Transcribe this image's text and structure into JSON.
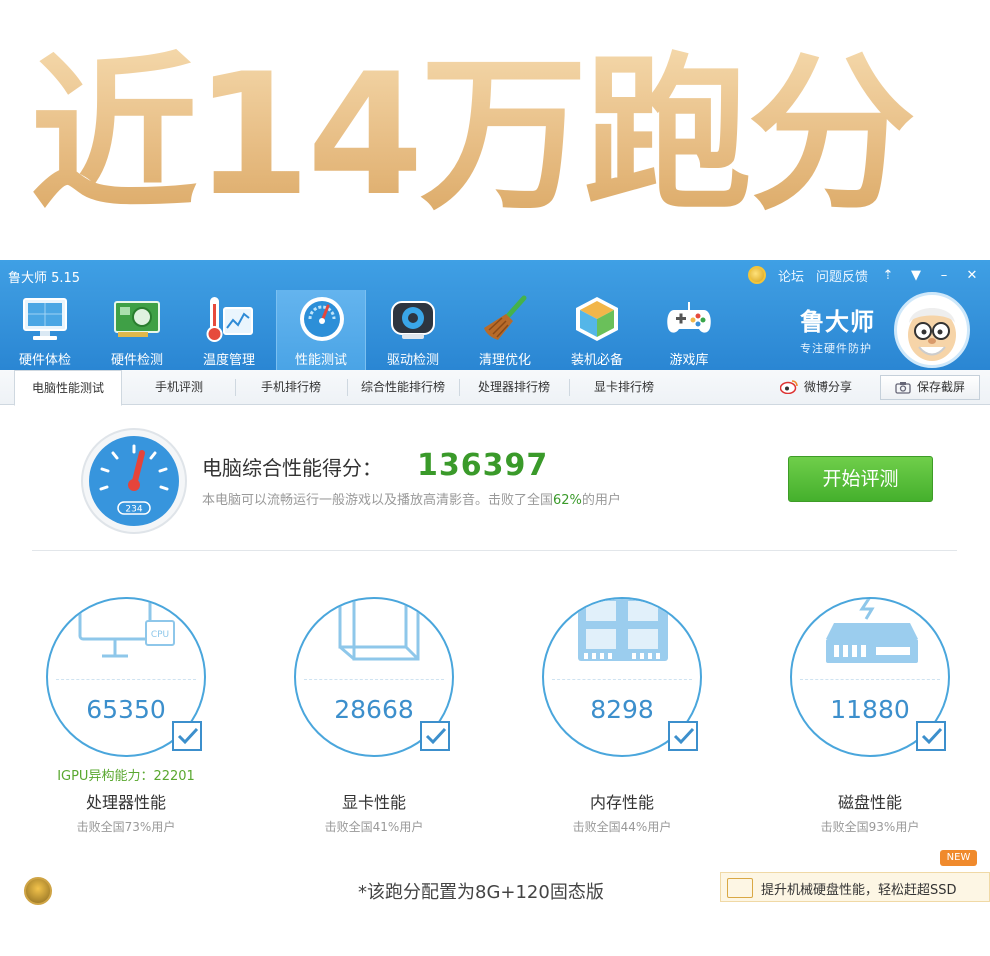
{
  "promo": {
    "headline": "近14万跑分"
  },
  "window": {
    "title": "鲁大师 5.15",
    "links": [
      "论坛",
      "问题反馈"
    ],
    "controls": [
      "skin-icon",
      "menu-icon",
      "minimize-icon",
      "close-icon"
    ]
  },
  "toolbar": {
    "items": [
      {
        "label": "硬件体检",
        "icon": "monitor-check-icon"
      },
      {
        "label": "硬件检测",
        "icon": "hardware-card-icon"
      },
      {
        "label": "温度管理",
        "icon": "thermometer-icon"
      },
      {
        "label": "性能测试",
        "icon": "speedometer-icon",
        "active": true
      },
      {
        "label": "驱动检测",
        "icon": "driver-gear-icon"
      },
      {
        "label": "清理优化",
        "icon": "broom-icon"
      },
      {
        "label": "装机必备",
        "icon": "box-icon"
      },
      {
        "label": "游戏库",
        "icon": "gamepad-icon"
      }
    ],
    "brand_name": "鲁大师",
    "brand_slogan": "专注硬件防护"
  },
  "tabs": {
    "items": [
      "电脑性能测试",
      "手机评测",
      "手机排行榜",
      "综合性能排行榜",
      "处理器排行榜",
      "显卡排行榜"
    ],
    "active": 0,
    "share": "微博分享",
    "save": "保存截屏"
  },
  "score": {
    "label": "电脑综合性能得分：",
    "value": "136397",
    "gauge_readout": "234",
    "desc_prefix": "本电脑可以流畅运行一般游戏以及播放高清影音。击败了全国",
    "desc_percent": "62%",
    "desc_suffix": "的用户",
    "start_button": "开始评测"
  },
  "components": [
    {
      "name": "处理器性能",
      "score": "65350",
      "defeat": "击败全国73%用户",
      "extra": "IGPU异构能力：22201",
      "icon": "cpu-monitor-icon"
    },
    {
      "name": "显卡性能",
      "score": "28668",
      "defeat": "击败全国41%用户",
      "extra": "",
      "icon": "gpu-cube-icon"
    },
    {
      "name": "内存性能",
      "score": "8298",
      "defeat": "击败全国44%用户",
      "extra": "",
      "icon": "memory-chip-icon"
    },
    {
      "name": "磁盘性能",
      "score": "11880",
      "defeat": "击败全国93%用户",
      "extra": "",
      "icon": "disk-drive-icon"
    }
  ],
  "footer": {
    "note": "*该跑分配置为8G+120固态版",
    "promo": "提升机械硬盘性能，轻松赶超SSD",
    "badge": "NEW"
  },
  "colors": {
    "brand_blue": "#2a86d3",
    "score_green": "#3a9a2a",
    "ring_blue": "#4aa6dc",
    "promo_gold": "#e7bd84"
  }
}
